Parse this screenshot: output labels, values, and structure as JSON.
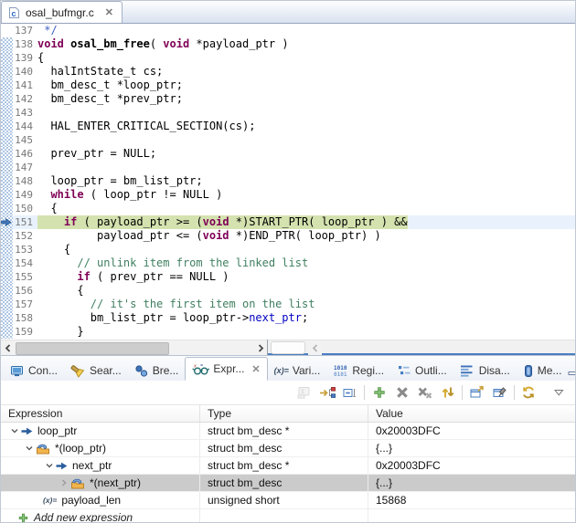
{
  "colors": {
    "keyword": "#7f0055",
    "comment": "#3f7f5f",
    "doc_comment": "#3f5fbf",
    "member_ref": "#0000c0",
    "line_number_gray": "#787878",
    "instruction_pointer_green": "#d4e2af",
    "current_line_blue": "#e9f2fc",
    "selected_row_gray": "#cbcbcb",
    "accent_blue": "#4a7fc1"
  },
  "editor": {
    "tab": {
      "title": "osal_bufmgr.c",
      "icon": "c-file-icon",
      "close_label": "✕"
    },
    "lines": [
      {
        "n": "137",
        "seg": [
          [
            "dc",
            " */"
          ]
        ]
      },
      {
        "n": "138",
        "seg": [
          [
            "k",
            "void"
          ],
          [
            "p",
            " "
          ],
          [
            "fn",
            "osal_bm_free"
          ],
          [
            "p",
            "( "
          ],
          [
            "k",
            "void"
          ],
          [
            "p",
            " *payload_ptr )"
          ]
        ]
      },
      {
        "n": "139",
        "seg": [
          [
            "p",
            "{"
          ]
        ]
      },
      {
        "n": "140",
        "seg": [
          [
            "p",
            "  halIntState_t cs;"
          ]
        ]
      },
      {
        "n": "141",
        "seg": [
          [
            "p",
            "  bm_desc_t *loop_ptr;"
          ]
        ]
      },
      {
        "n": "142",
        "seg": [
          [
            "p",
            "  bm_desc_t *prev_ptr;"
          ]
        ]
      },
      {
        "n": "143",
        "seg": []
      },
      {
        "n": "144",
        "seg": [
          [
            "p",
            "  HAL_ENTER_CRITICAL_SECTION(cs);"
          ]
        ]
      },
      {
        "n": "145",
        "seg": []
      },
      {
        "n": "146",
        "seg": [
          [
            "p",
            "  prev_ptr = NULL;"
          ]
        ]
      },
      {
        "n": "147",
        "seg": []
      },
      {
        "n": "148",
        "seg": [
          [
            "p",
            "  loop_ptr = bm_list_ptr;"
          ]
        ]
      },
      {
        "n": "149",
        "seg": [
          [
            "p",
            "  "
          ],
          [
            "k",
            "while"
          ],
          [
            "p",
            " ( loop_ptr != NULL )"
          ]
        ]
      },
      {
        "n": "150",
        "seg": [
          [
            "p",
            "  {"
          ]
        ]
      },
      {
        "n": "151",
        "ip": true,
        "seg": [
          [
            "p",
            "    "
          ],
          [
            "k",
            "if"
          ],
          [
            "p",
            " ( payload_ptr >= ("
          ],
          [
            "k",
            "void"
          ],
          [
            "p",
            " *)START_PTR( loop_ptr ) &&"
          ]
        ]
      },
      {
        "n": "152",
        "seg": [
          [
            "p",
            "         payload_ptr <= ("
          ],
          [
            "k",
            "void"
          ],
          [
            "p",
            " *)END_PTR( loop_ptr) )"
          ]
        ]
      },
      {
        "n": "153",
        "seg": [
          [
            "p",
            "    {"
          ]
        ]
      },
      {
        "n": "154",
        "seg": [
          [
            "cm",
            "      // unlink item from the linked list"
          ]
        ]
      },
      {
        "n": "155",
        "seg": [
          [
            "p",
            "      "
          ],
          [
            "k",
            "if"
          ],
          [
            "p",
            " ( prev_ptr == NULL )"
          ]
        ]
      },
      {
        "n": "156",
        "seg": [
          [
            "p",
            "      {"
          ]
        ]
      },
      {
        "n": "157",
        "seg": [
          [
            "cm",
            "        // it's the first item on the list"
          ]
        ]
      },
      {
        "n": "158",
        "seg": [
          [
            "p",
            "        bm_list_ptr = loop_ptr->"
          ],
          [
            "mem",
            "next_ptr"
          ],
          [
            "p",
            ";"
          ]
        ]
      },
      {
        "n": "159",
        "seg": [
          [
            "p",
            "      }"
          ]
        ]
      }
    ]
  },
  "panel": {
    "tabs": [
      {
        "label": "Con...",
        "icon": "console-icon"
      },
      {
        "label": "Sear...",
        "icon": "search-icon"
      },
      {
        "label": "Bre...",
        "icon": "breakpoints-icon"
      },
      {
        "label": "Expr...",
        "icon": "expressions-icon",
        "active": true,
        "close_label": "✕"
      },
      {
        "label": "Vari...",
        "icon": "variables-icon"
      },
      {
        "label": "Regi...",
        "icon": "registers-icon"
      },
      {
        "label": "Outli...",
        "icon": "outline-icon"
      },
      {
        "label": "Disa...",
        "icon": "disassembly-icon"
      },
      {
        "label": "Me...",
        "icon": "memory-icon"
      }
    ],
    "window_controls": [
      {
        "name": "minimize"
      },
      {
        "name": "maximize"
      }
    ],
    "toolbar": [
      {
        "name": "show-type-names",
        "disabled": true
      },
      {
        "name": "show-logical-structure"
      },
      {
        "name": "collapse-all"
      },
      {
        "sep": true
      },
      {
        "name": "add-expression"
      },
      {
        "name": "remove-expression"
      },
      {
        "name": "remove-all-expressions"
      },
      {
        "name": "reevaluate"
      },
      {
        "sep": true
      },
      {
        "name": "open-new-view"
      },
      {
        "name": "pin-view"
      },
      {
        "sep": true
      },
      {
        "name": "refresh"
      },
      {
        "name": "view-menu",
        "menu": true
      }
    ],
    "table": {
      "columns": [
        "Expression",
        "Type",
        "Value"
      ],
      "rows": [
        {
          "depth": 0,
          "state": "expanded",
          "icon": "pointer-icon",
          "expr": "loop_ptr",
          "type": "struct bm_desc *",
          "value": "0x20003DFC"
        },
        {
          "depth": 1,
          "state": "expanded",
          "icon": "struct-icon",
          "expr": "*(loop_ptr)",
          "type": "struct bm_desc",
          "value": "{...}"
        },
        {
          "depth": 2,
          "state": "expanded",
          "icon": "pointer-icon",
          "expr": "next_ptr",
          "type": "struct bm_desc *",
          "value": "0x20003DFC"
        },
        {
          "depth": 3,
          "state": "collapsed",
          "icon": "struct-icon",
          "expr": "*(next_ptr)",
          "type": "struct bm_desc",
          "value": "{...}",
          "selected": true
        },
        {
          "depth": 2,
          "state": "leaf",
          "icon": "variable-icon",
          "expr": "payload_len",
          "type": "unsigned short",
          "value": "15868"
        },
        {
          "depth": 0,
          "state": "leaf",
          "icon": "add-small-icon",
          "expr": "Add new expression",
          "type": "",
          "value": "",
          "add_row": true
        }
      ]
    }
  }
}
